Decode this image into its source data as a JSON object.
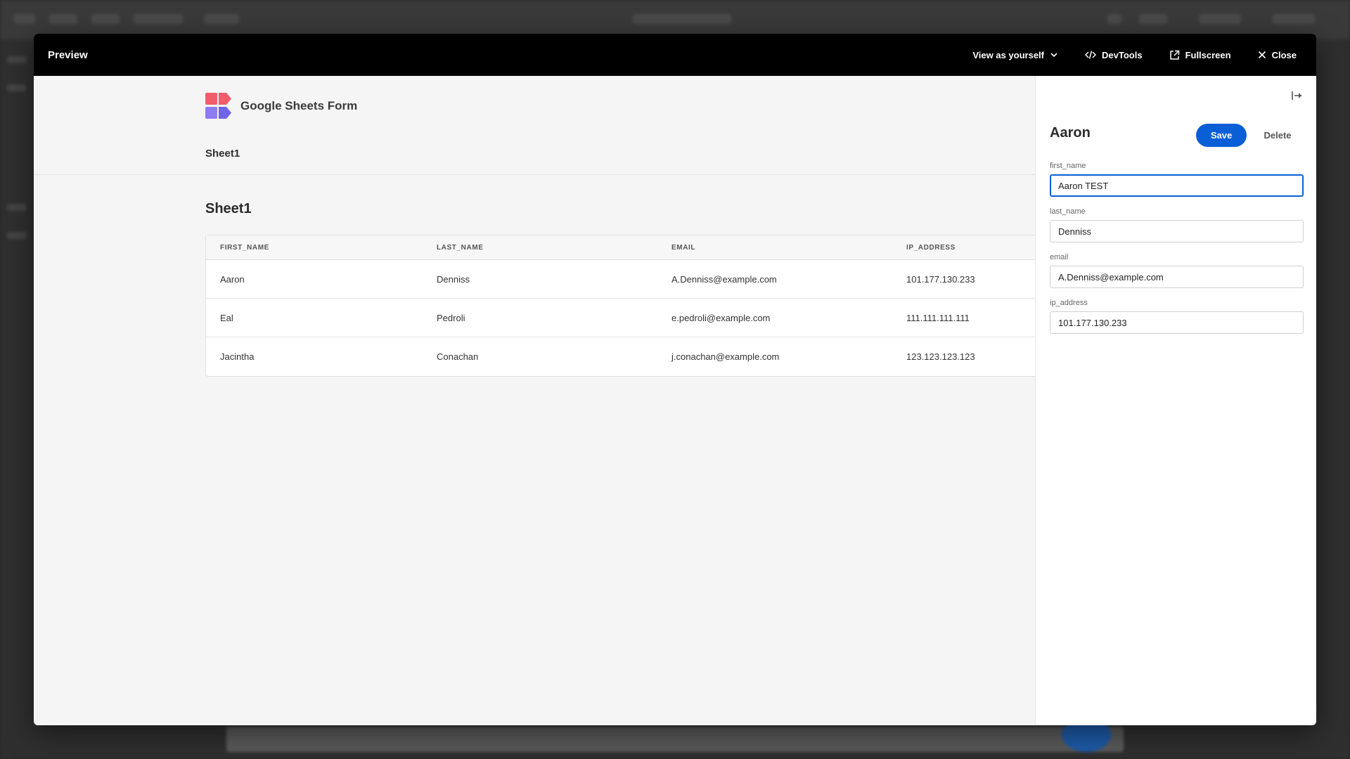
{
  "modal": {
    "title": "Preview",
    "actions": {
      "view_as": "View as yourself",
      "devtools": "DevTools",
      "fullscreen": "Fullscreen",
      "close": "Close"
    }
  },
  "app": {
    "brand_title": "Google Sheets Form",
    "nav_tab": "Sheet1",
    "section_title": "Sheet1",
    "table": {
      "columns": [
        "FIRST_NAME",
        "LAST_NAME",
        "EMAIL",
        "IP_ADDRESS"
      ],
      "rows": [
        [
          "Aaron",
          "Denniss",
          "A.Denniss@example.com",
          "101.177.130.233"
        ],
        [
          "Eal",
          "Pedroli",
          "e.pedroli@example.com",
          "111.111.111.111"
        ],
        [
          "Jacintha",
          "Conachan",
          "j.conachan@example.com",
          "123.123.123.123"
        ]
      ]
    }
  },
  "panel": {
    "title": "Aaron",
    "save_label": "Save",
    "delete_label": "Delete",
    "fields": [
      {
        "label": "first_name",
        "value": "Aaron TEST"
      },
      {
        "label": "last_name",
        "value": "Denniss"
      },
      {
        "label": "email",
        "value": "A.Denniss@example.com"
      },
      {
        "label": "ip_address",
        "value": "101.177.130.233"
      }
    ]
  },
  "colors": {
    "accent": "#0b5fd6",
    "header_bg": "#000000",
    "logo_red": "#f25d6b",
    "logo_purple": "#8d7cf0"
  },
  "icons": {
    "view_as": "chevron-down-icon",
    "devtools": "code-icon",
    "fullscreen": "external-link-icon",
    "close": "close-icon",
    "collapse": "collapse-panel-icon",
    "brand": "budibase-logo-icon"
  }
}
